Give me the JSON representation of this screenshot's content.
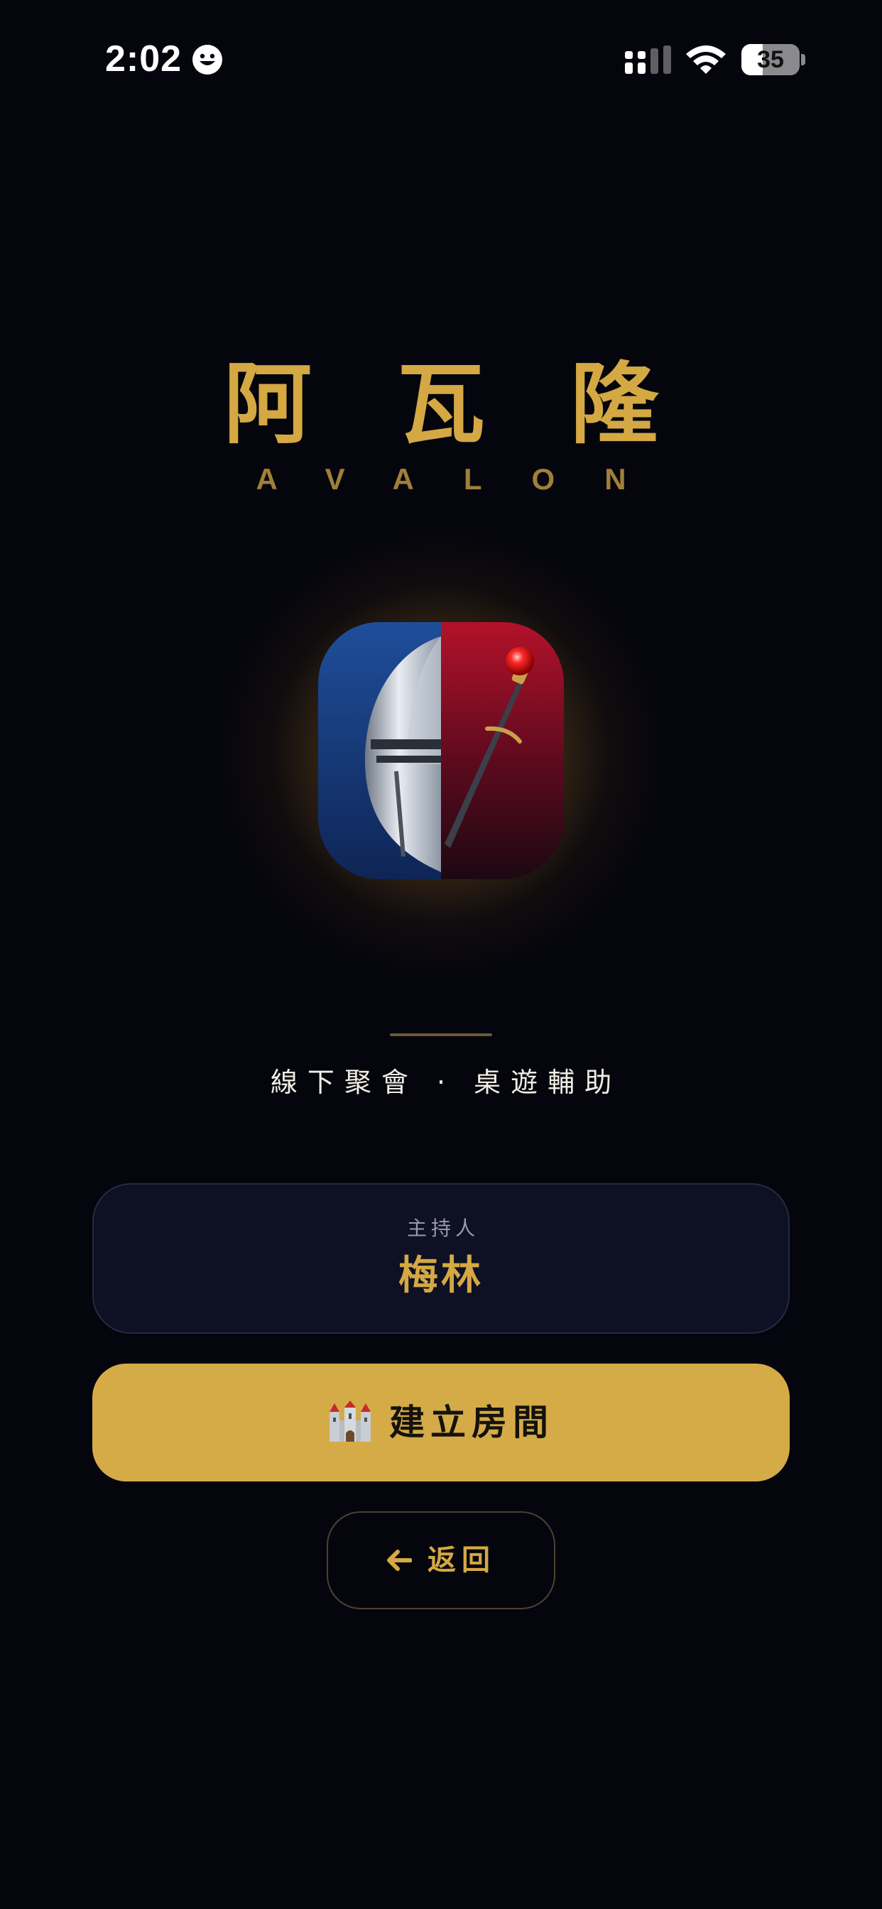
{
  "status_bar": {
    "time": "2:02",
    "battery_level": "35",
    "icons": [
      "smiley-icon",
      "cellular-signal-icon",
      "wifi-icon",
      "battery-icon"
    ]
  },
  "header": {
    "title_cn": "阿瓦隆",
    "title_en": "AVALON"
  },
  "emblem": {
    "icon": "knight-helmet-sword-emblem"
  },
  "subtitle": "線下聚會 · 桌遊輔助",
  "host": {
    "label": "主持人",
    "name": "梅林"
  },
  "actions": {
    "create_room": {
      "icon": "castle-icon",
      "label": "建立房間"
    },
    "back": {
      "icon": "arrow-left-icon",
      "label": "返回"
    }
  },
  "colors": {
    "background": "#05050d",
    "gold": "#d4a843",
    "button_gold": "#d4ab47",
    "card": "#0e1024",
    "text_light": "#f0ede4"
  }
}
